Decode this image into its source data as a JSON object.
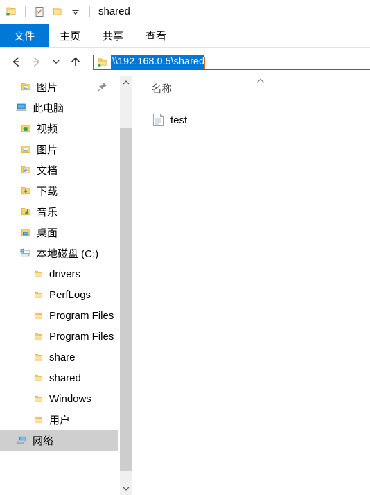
{
  "window": {
    "title": "shared",
    "quick_access": [
      {
        "name": "save-to-folder-icon",
        "label": ""
      },
      {
        "name": "properties-icon",
        "label": ""
      },
      {
        "name": "new-folder-icon",
        "label": ""
      },
      {
        "name": "customize-quick-access-chevron-icon",
        "label": ""
      }
    ]
  },
  "ribbon": {
    "tabs": [
      {
        "label": "文件",
        "active": true
      },
      {
        "label": "主页",
        "active": false
      },
      {
        "label": "共享",
        "active": false
      },
      {
        "label": "查看",
        "active": false
      }
    ]
  },
  "navbar": {
    "back_tooltip": "后退",
    "forward_tooltip": "前进",
    "recent_tooltip": "最近浏览的位置",
    "up_tooltip": "上移一级",
    "address": {
      "value": "\\\\192.168.0.5\\shared",
      "selected": true
    }
  },
  "sidebar": {
    "items": [
      {
        "label": "图片",
        "icon": "folder-pictures-icon",
        "level": 1,
        "pinned": true,
        "selected": false
      },
      {
        "label": "此电脑",
        "icon": "this-pc-icon",
        "level": 0,
        "pinned": false,
        "selected": false
      },
      {
        "label": "视频",
        "icon": "folder-videos-icon",
        "level": 1,
        "pinned": false,
        "selected": false
      },
      {
        "label": "图片",
        "icon": "folder-pictures-icon",
        "level": 1,
        "pinned": false,
        "selected": false
      },
      {
        "label": "文档",
        "icon": "folder-documents-icon",
        "level": 1,
        "pinned": false,
        "selected": false
      },
      {
        "label": "下载",
        "icon": "folder-downloads-icon",
        "level": 1,
        "pinned": false,
        "selected": false
      },
      {
        "label": "音乐",
        "icon": "folder-music-icon",
        "level": 1,
        "pinned": false,
        "selected": false
      },
      {
        "label": "桌面",
        "icon": "folder-desktop-icon",
        "level": 1,
        "pinned": false,
        "selected": false
      },
      {
        "label": "本地磁盘 (C:)",
        "icon": "local-disk-icon",
        "level": 1,
        "pinned": false,
        "selected": false
      },
      {
        "label": "drivers",
        "icon": "folder-icon",
        "level": 2,
        "pinned": false,
        "selected": false
      },
      {
        "label": "PerfLogs",
        "icon": "folder-icon",
        "level": 2,
        "pinned": false,
        "selected": false
      },
      {
        "label": "Program Files",
        "icon": "folder-icon",
        "level": 2,
        "pinned": false,
        "selected": false
      },
      {
        "label": "Program Files",
        "icon": "folder-icon",
        "level": 2,
        "pinned": false,
        "selected": false
      },
      {
        "label": "share",
        "icon": "folder-icon",
        "level": 2,
        "pinned": false,
        "selected": false
      },
      {
        "label": "shared",
        "icon": "folder-icon",
        "level": 2,
        "pinned": false,
        "selected": false
      },
      {
        "label": "Windows",
        "icon": "folder-icon",
        "level": 2,
        "pinned": false,
        "selected": false
      },
      {
        "label": "用户",
        "icon": "folder-icon",
        "level": 2,
        "pinned": false,
        "selected": false
      },
      {
        "label": "网络",
        "icon": "network-icon",
        "level": 0,
        "pinned": false,
        "selected": true
      }
    ]
  },
  "scrollbar": {
    "up_arrow": "▲",
    "down_arrow": "▼"
  },
  "filelist": {
    "columns": [
      {
        "label": "名称",
        "sorted": "asc"
      }
    ],
    "rows": [
      {
        "name": "test",
        "icon": "text-file-icon"
      }
    ]
  },
  "colors": {
    "accent": "#0078d7",
    "selection": "#0078d7",
    "tree_selection": "#cfcfcf",
    "scroll_thumb": "#cdcdcd",
    "scroll_track": "#f0f0f0",
    "folder_yellow": "#ffd264",
    "caret": "#d86a20"
  }
}
